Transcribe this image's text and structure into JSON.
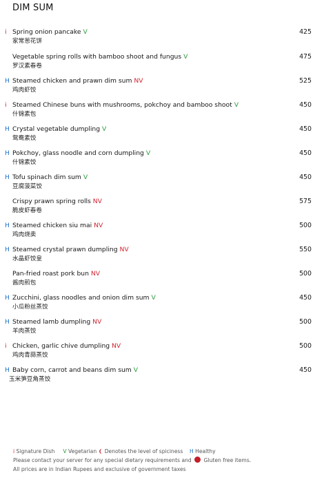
{
  "section_title": "DIM SUM",
  "colors": {
    "healthy": "#1e73c8",
    "signature": "#d0202e",
    "vegetarian": "#2a9a3a",
    "non_veg": "#d0202e"
  },
  "items": [
    {
      "tag": "i",
      "name": "Spring onion pancake",
      "diet": "V",
      "zh": "家常葱花饼",
      "price": "425"
    },
    {
      "tag": "",
      "name": "Vegetable spring rolls with bamboo shoot and fungus",
      "diet": "V",
      "zh": "罗汉素春卷",
      "price": "475"
    },
    {
      "tag": "H",
      "name": "Steamed chicken and prawn dim sum",
      "diet": "NV",
      "zh": "鸡肉虾饺",
      "price": "525"
    },
    {
      "tag": "i",
      "name": "Steamed Chinese buns with mushrooms, pokchoy and bamboo shoot",
      "diet": "V",
      "zh": "什锦素包",
      "price": "450"
    },
    {
      "tag": "H",
      "name": "Crystal vegetable dumpling",
      "diet": "V",
      "zh": "鸳鸯素饺",
      "price": "450"
    },
    {
      "tag": "H",
      "name": "Pokchoy, glass noodle and corn dumpling",
      "diet": "V",
      "zh": "什锦素饺",
      "price": "450"
    },
    {
      "tag": "H",
      "name": "Tofu spinach dim sum",
      "diet": "V",
      "zh": "豆腐菠菜饺",
      "price": "450"
    },
    {
      "tag": "",
      "name": "Crispy prawn spring rolls",
      "diet": "NV",
      "zh": "脆皮虾春卷",
      "price": "575"
    },
    {
      "tag": "H",
      "name": "Steamed chicken siu mai",
      "diet": "NV",
      "zh": "鸡肉烧卖",
      "price": "500"
    },
    {
      "tag": "H",
      "name": "Steamed crystal prawn dumpling",
      "diet": "NV",
      "zh": "水晶虾饺皇",
      "price": "550"
    },
    {
      "tag": "",
      "name": "Pan-fried roast pork bun",
      "diet": "NV",
      "zh": "酱肉煎包",
      "price": "500"
    },
    {
      "tag": "H",
      "name": "Zucchini, glass noodles and onion dim sum",
      "diet": "V",
      "zh": "小瓜粉丝蒸饺",
      "price": "450"
    },
    {
      "tag": "H",
      "name": "Steamed lamb dumpling",
      "diet": "NV",
      "zh": "羊肉蒸饺",
      "price": "500"
    },
    {
      "tag": "i",
      "name": "Chicken, garlic chive dumpling",
      "diet": "NV",
      "zh": "鸡肉青蒜蒸饺",
      "price": "500"
    },
    {
      "tag": "H",
      "name": "Baby corn, carrot and beans dim sum",
      "diet": "V",
      "zh": "玉米笋豆角蒸饺",
      "price": "450"
    }
  ],
  "footer": {
    "signature_key": "i",
    "signature_text": "Signature Dish",
    "veg_key": "V",
    "veg_text": "Vegetarian",
    "spice_text": "Denotes the level of spiciness",
    "healthy_key": "H",
    "healthy_text": "Healthy",
    "dietary_text": "Please contact your server for any special dietary requirements and",
    "gluten_text": "Gluten free items.",
    "prices_text": "All prices are in Indian Rupees and exclusive of government taxes"
  }
}
